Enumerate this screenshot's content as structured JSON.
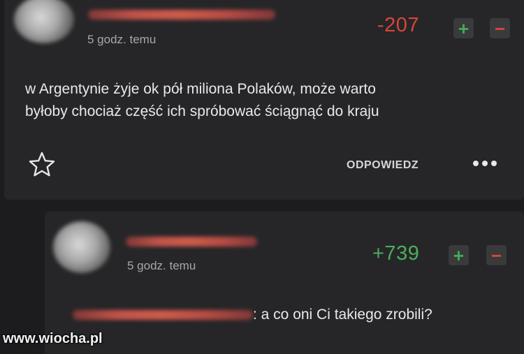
{
  "comments": [
    {
      "time_ago": "5 godz. temu",
      "score": "-207",
      "vote_plus": "+",
      "vote_minus": "−",
      "text_lines": [
        "w Argentynie żyje ok pół miliona Polaków, może warto",
        "byłoby chociaż część ich spróbować ściągnąć do kraju"
      ],
      "reply_label": "ODPOWIEDZ"
    },
    {
      "time_ago": "5 godz. temu",
      "score": "+739",
      "vote_plus": "+",
      "vote_minus": "−",
      "text": ": a co oni Ci takiego zrobili?"
    }
  ],
  "watermark": "www.wiocha.pl",
  "colors": {
    "background": "#1c1c1e",
    "card": "#262628",
    "negative": "#d9453b",
    "positive": "#4caf5a"
  },
  "icons": {
    "favorite": "star-outline-icon",
    "more": "more-dots-icon"
  }
}
